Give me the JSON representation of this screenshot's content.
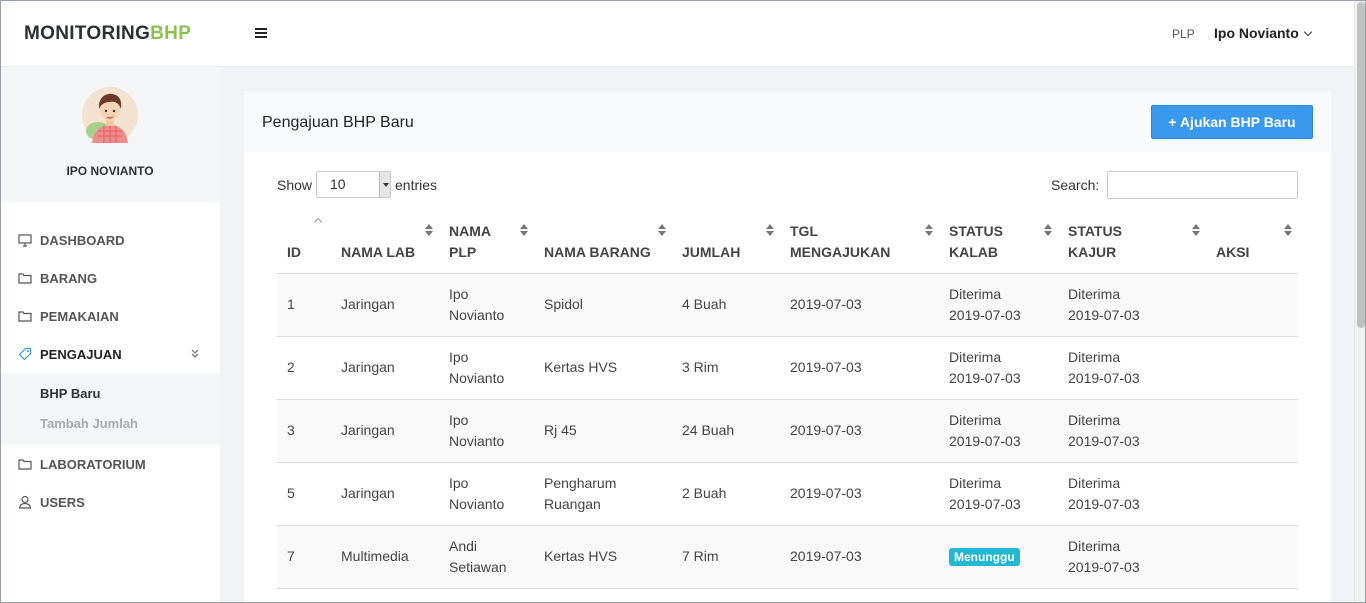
{
  "brand": {
    "part1": "MONITORING",
    "part2": "BHP"
  },
  "header": {
    "role": "PLP",
    "user_name": "Ipo Novianto"
  },
  "profile": {
    "name": "IPO NOVIANTO"
  },
  "sidebar": {
    "items": [
      {
        "label": "DASHBOARD",
        "icon": "monitor-icon"
      },
      {
        "label": "BARANG",
        "icon": "folder-icon"
      },
      {
        "label": "PEMAKAIAN",
        "icon": "folder-icon"
      },
      {
        "label": "PENGAJUAN",
        "icon": "tag-icon"
      },
      {
        "label": "LABORATORIUM",
        "icon": "folder-icon"
      },
      {
        "label": "USERS",
        "icon": "user-icon"
      }
    ],
    "submenu": [
      {
        "label": "BHP Baru"
      },
      {
        "label": "Tambah Jumlah"
      }
    ]
  },
  "card": {
    "title": "Pengajuan BHP Baru",
    "add_button": "Ajukan BHP Baru",
    "show_label": "Show",
    "entries_value": "10",
    "entries_label": "entries",
    "search_label": "Search:",
    "search_value": ""
  },
  "table": {
    "headers": [
      {
        "l1": "",
        "l2": "ID"
      },
      {
        "l1": "",
        "l2": "NAMA LAB"
      },
      {
        "l1": "NAMA",
        "l2": "PLP"
      },
      {
        "l1": "",
        "l2": "NAMA BARANG"
      },
      {
        "l1": "",
        "l2": "JUMLAH"
      },
      {
        "l1": "TGL",
        "l2": "MENGAJUKAN"
      },
      {
        "l1": "STATUS",
        "l2": "KALAB"
      },
      {
        "l1": "STATUS",
        "l2": "KAJUR"
      },
      {
        "l1": "",
        "l2": "AKSI"
      }
    ],
    "rows": [
      {
        "id": "1",
        "lab": "Jaringan",
        "plp1": "Ipo",
        "plp2": "Novianto",
        "barang1": "Spidol",
        "barang2": "",
        "jumlah": "4 Buah",
        "tgl": "2019-07-03",
        "kalab_status": "Diterima",
        "kalab_date": "2019-07-03",
        "kalab_badge": "",
        "kajur_status": "Diterima",
        "kajur_date": "2019-07-03"
      },
      {
        "id": "2",
        "lab": "Jaringan",
        "plp1": "Ipo",
        "plp2": "Novianto",
        "barang1": "Kertas HVS",
        "barang2": "",
        "jumlah": "3 Rim",
        "tgl": "2019-07-03",
        "kalab_status": "Diterima",
        "kalab_date": "2019-07-03",
        "kalab_badge": "",
        "kajur_status": "Diterima",
        "kajur_date": "2019-07-03"
      },
      {
        "id": "3",
        "lab": "Jaringan",
        "plp1": "Ipo",
        "plp2": "Novianto",
        "barang1": "Rj 45",
        "barang2": "",
        "jumlah": "24 Buah",
        "tgl": "2019-07-03",
        "kalab_status": "Diterima",
        "kalab_date": "2019-07-03",
        "kalab_badge": "",
        "kajur_status": "Diterima",
        "kajur_date": "2019-07-03"
      },
      {
        "id": "5",
        "lab": "Jaringan",
        "plp1": "Ipo",
        "plp2": "Novianto",
        "barang1": "Pengharum",
        "barang2": "Ruangan",
        "jumlah": "2 Buah",
        "tgl": "2019-07-03",
        "kalab_status": "Diterima",
        "kalab_date": "2019-07-03",
        "kalab_badge": "",
        "kajur_status": "Diterima",
        "kajur_date": "2019-07-03"
      },
      {
        "id": "7",
        "lab": "Multimedia",
        "plp1": "Andi",
        "plp2": "Setiawan",
        "barang1": "Kertas HVS",
        "barang2": "",
        "jumlah": "7 Rim",
        "tgl": "2019-07-03",
        "kalab_status": "",
        "kalab_date": "",
        "kalab_badge": "Menunggu",
        "kajur_status": "Diterima",
        "kajur_date": "2019-07-03"
      }
    ]
  },
  "colors": {
    "brand_accent": "#8cc152",
    "primary_button": "#3a99ed",
    "badge_info": "#22b8cf"
  }
}
